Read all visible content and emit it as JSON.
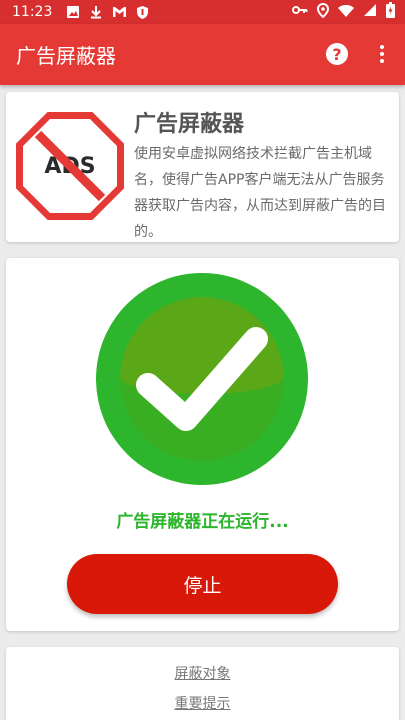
{
  "status_bar": {
    "time": "11:23",
    "left_icons": [
      "image-icon",
      "download-icon",
      "gmail-icon",
      "shield-icon"
    ],
    "right_icons": [
      "vpn-key-icon",
      "location-icon",
      "wifi-icon",
      "signal-icon",
      "battery-icon"
    ]
  },
  "app_bar": {
    "title": "广告屏蔽器",
    "help_icon": "help-icon",
    "menu_icon": "more-vert-icon",
    "color": "#e53935"
  },
  "info_card": {
    "logo_text": "ADS",
    "title": "广告屏蔽器",
    "description": "使用安卓虚拟网络技术拦截广告主机域名，使得广告APP客户端无法从广告服务器获取广告内容，从而达到屏蔽广告的目的。"
  },
  "status_card": {
    "status_icon": "check-circle-icon",
    "status_text": "广告屏蔽器正在运行...",
    "stop_label": "停止",
    "status_color": "#2db52d",
    "button_color": "#d81909"
  },
  "links": {
    "blocked_targets": "屏蔽对象",
    "important_notice": "重要提示"
  }
}
